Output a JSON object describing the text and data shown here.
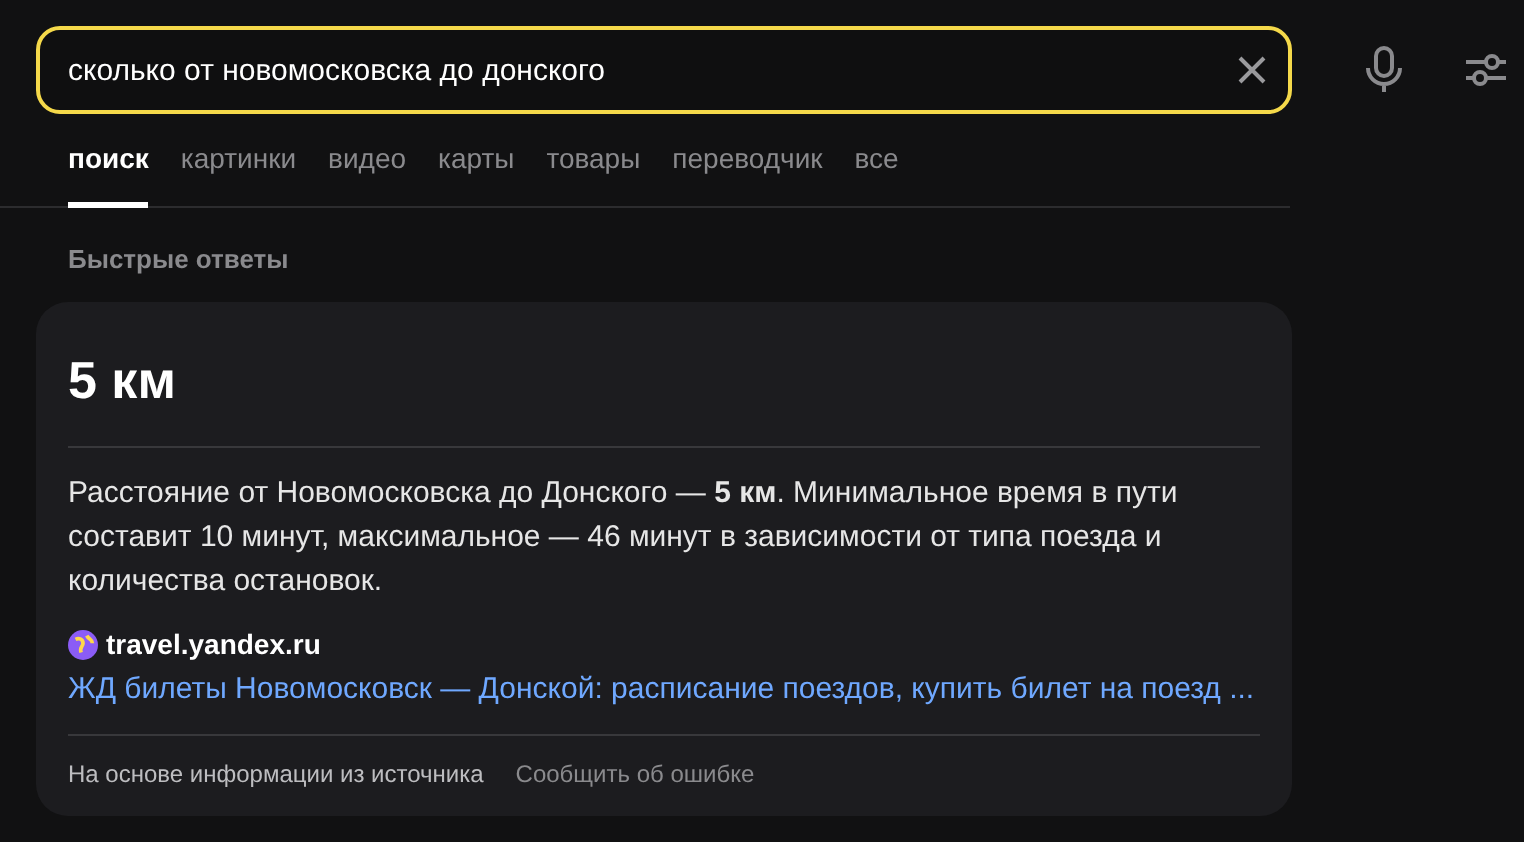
{
  "search": {
    "value": "сколько от новомосковска до донского"
  },
  "tabs": [
    {
      "label": "поиск",
      "selected": true
    },
    {
      "label": "картинки",
      "selected": false
    },
    {
      "label": "видео",
      "selected": false
    },
    {
      "label": "карты",
      "selected": false
    },
    {
      "label": "товары",
      "selected": false
    },
    {
      "label": "переводчик",
      "selected": false
    },
    {
      "label": "все",
      "selected": false
    }
  ],
  "section_title": "Быстрые ответы",
  "answer": {
    "headline": "5 км",
    "text": "Расстояние от Новомосковска до Донского — **5 км**. Минимальное время в пути составит 10 минут, максимальное — 46 минут в зависимости от типа поезда и количества остановок.",
    "source_domain": "travel.yandex.ru",
    "source_link": "ЖД билеты Новомосковск — Донской: расписание поездов, купить билет на поезд ...",
    "footer": [
      "На основе информации из источника",
      "Сообщить об ошибке"
    ]
  }
}
